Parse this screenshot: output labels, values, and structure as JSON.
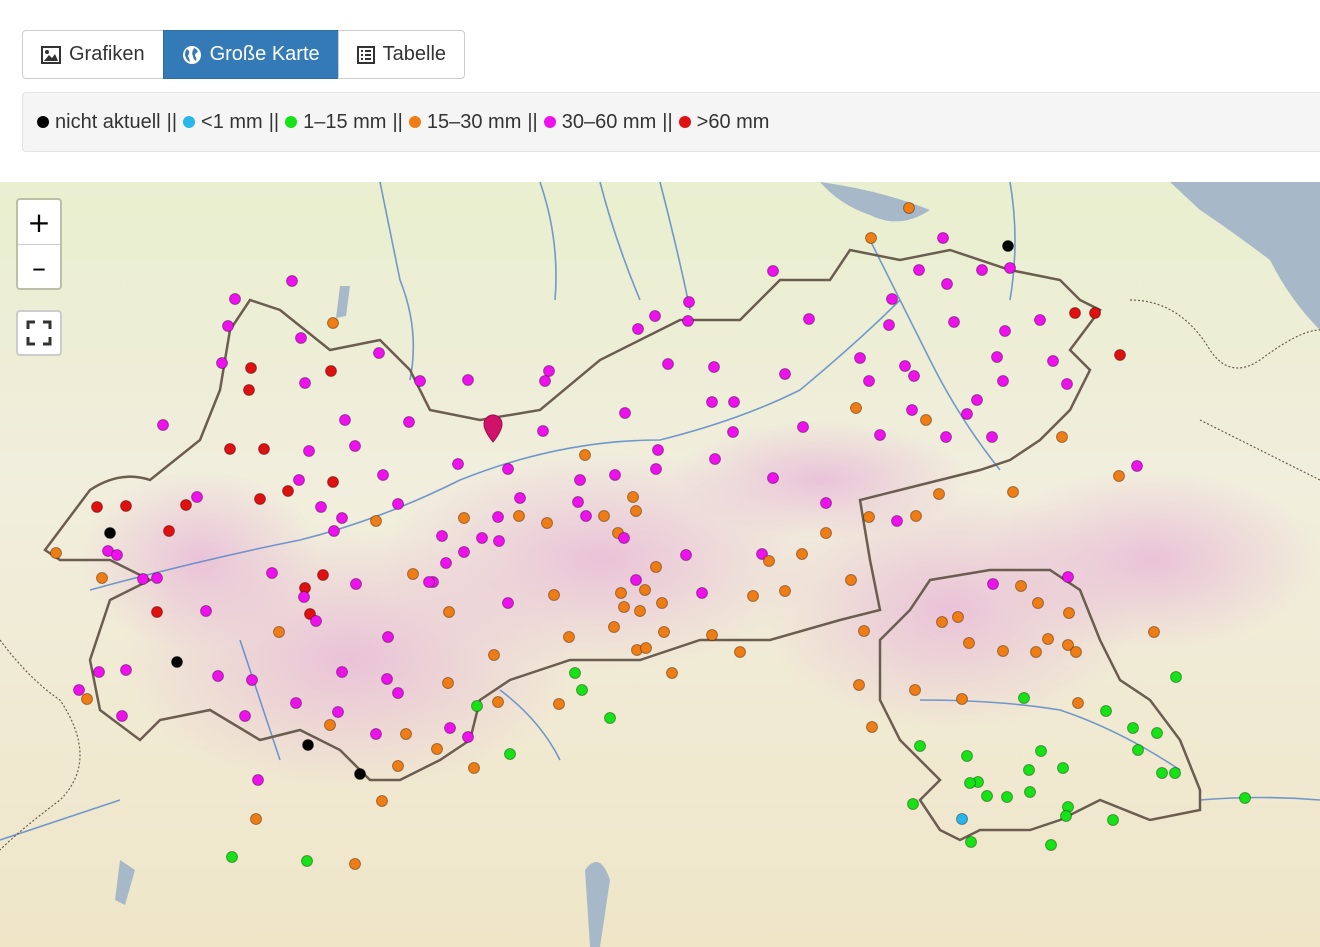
{
  "tabs": [
    {
      "label": "Grafiken",
      "icon": "image-icon",
      "active": false
    },
    {
      "label": "Große Karte",
      "icon": "globe-icon",
      "active": true
    },
    {
      "label": "Tabelle",
      "icon": "list-icon",
      "active": false
    }
  ],
  "legend": {
    "items": [
      {
        "label": "nicht aktuell",
        "color": "#000000"
      },
      {
        "label": "<1 mm",
        "color": "#29b6e8"
      },
      {
        "label": "1–15 mm",
        "color": "#16e316"
      },
      {
        "label": "15–30 mm",
        "color": "#f07d14"
      },
      {
        "label": "30–60 mm",
        "color": "#ee11ee"
      },
      {
        "label": ">60 mm",
        "color": "#e01010"
      }
    ],
    "separator": "||"
  },
  "map_controls": {
    "zoom_in": "+",
    "zoom_out": "–",
    "fullscreen_icon": "fullscreen-icon"
  },
  "colors": {
    "black": "#000000",
    "blue": "#29b6e8",
    "green": "#16e316",
    "orange": "#f07d14",
    "magenta": "#ee11ee",
    "red": "#e01010"
  },
  "stations": [
    [
      333,
      323,
      "o"
    ],
    [
      292,
      281,
      "m"
    ],
    [
      235,
      299,
      "m"
    ],
    [
      228,
      326,
      "m"
    ],
    [
      301,
      338,
      "m"
    ],
    [
      379,
      353,
      "m"
    ],
    [
      222,
      363,
      "m"
    ],
    [
      251,
      368,
      "r"
    ],
    [
      305,
      383,
      "m"
    ],
    [
      331,
      371,
      "r"
    ],
    [
      249,
      390,
      "r"
    ],
    [
      163,
      425,
      "m"
    ],
    [
      345,
      420,
      "m"
    ],
    [
      420,
      381,
      "m"
    ],
    [
      468,
      380,
      "m"
    ],
    [
      409,
      422,
      "m"
    ],
    [
      230,
      449,
      "r"
    ],
    [
      264,
      449,
      "r"
    ],
    [
      309,
      451,
      "m"
    ],
    [
      355,
      446,
      "m"
    ],
    [
      383,
      475,
      "m"
    ],
    [
      458,
      464,
      "m"
    ],
    [
      333,
      482,
      "r"
    ],
    [
      288,
      491,
      "r"
    ],
    [
      299,
      480,
      "m"
    ],
    [
      197,
      497,
      "m"
    ],
    [
      186,
      505,
      "r"
    ],
    [
      260,
      499,
      "r"
    ],
    [
      126,
      506,
      "r"
    ],
    [
      97,
      507,
      "r"
    ],
    [
      110,
      533,
      "k"
    ],
    [
      169,
      531,
      "r"
    ],
    [
      321,
      507,
      "m"
    ],
    [
      342,
      518,
      "m"
    ],
    [
      398,
      504,
      "m"
    ],
    [
      376,
      521,
      "o"
    ],
    [
      334,
      531,
      "m"
    ],
    [
      56,
      553,
      "o"
    ],
    [
      108,
      551,
      "m"
    ],
    [
      117,
      555,
      "m"
    ],
    [
      102,
      578,
      "o"
    ],
    [
      143,
      579,
      "m"
    ],
    [
      157,
      578,
      "m"
    ],
    [
      272,
      573,
      "m"
    ],
    [
      305,
      588,
      "r"
    ],
    [
      323,
      575,
      "r"
    ],
    [
      356,
      584,
      "m"
    ],
    [
      157,
      612,
      "r"
    ],
    [
      206,
      611,
      "m"
    ],
    [
      304,
      597,
      "m"
    ],
    [
      310,
      614,
      "r"
    ],
    [
      316,
      621,
      "m"
    ],
    [
      279,
      632,
      "o"
    ],
    [
      177,
      662,
      "k"
    ],
    [
      99,
      672,
      "m"
    ],
    [
      126,
      670,
      "m"
    ],
    [
      79,
      690,
      "m"
    ],
    [
      87,
      699,
      "o"
    ],
    [
      218,
      676,
      "m"
    ],
    [
      252,
      680,
      "m"
    ],
    [
      342,
      672,
      "m"
    ],
    [
      388,
      637,
      "m"
    ],
    [
      387,
      679,
      "m"
    ],
    [
      398,
      693,
      "m"
    ],
    [
      296,
      703,
      "m"
    ],
    [
      338,
      712,
      "m"
    ],
    [
      245,
      716,
      "m"
    ],
    [
      122,
      716,
      "m"
    ],
    [
      308,
      745,
      "k"
    ],
    [
      330,
      725,
      "o"
    ],
    [
      376,
      734,
      "m"
    ],
    [
      406,
      734,
      "o"
    ],
    [
      360,
      774,
      "k"
    ],
    [
      398,
      766,
      "o"
    ],
    [
      437,
      749,
      "o"
    ],
    [
      450,
      728,
      "m"
    ],
    [
      468,
      737,
      "m"
    ],
    [
      474,
      768,
      "o"
    ],
    [
      382,
      801,
      "o"
    ],
    [
      258,
      780,
      "m"
    ],
    [
      256,
      819,
      "o"
    ],
    [
      232,
      857,
      "g"
    ],
    [
      307,
      861,
      "g"
    ],
    [
      355,
      864,
      "o"
    ],
    [
      442,
      536,
      "m"
    ],
    [
      464,
      518,
      "o"
    ],
    [
      464,
      552,
      "m"
    ],
    [
      482,
      538,
      "m"
    ],
    [
      499,
      541,
      "m"
    ],
    [
      498,
      517,
      "m"
    ],
    [
      519,
      516,
      "o"
    ],
    [
      520,
      498,
      "m"
    ],
    [
      547,
      523,
      "o"
    ],
    [
      508,
      469,
      "m"
    ],
    [
      543,
      431,
      "m"
    ],
    [
      549,
      371,
      "m"
    ],
    [
      545,
      381,
      "m"
    ],
    [
      585,
      455,
      "o"
    ],
    [
      580,
      480,
      "m"
    ],
    [
      615,
      475,
      "m"
    ],
    [
      578,
      502,
      "m"
    ],
    [
      586,
      516,
      "m"
    ],
    [
      604,
      516,
      "o"
    ],
    [
      618,
      533,
      "o"
    ],
    [
      624,
      538,
      "m"
    ],
    [
      633,
      497,
      "o"
    ],
    [
      636,
      511,
      "o"
    ],
    [
      625,
      413,
      "m"
    ],
    [
      655,
      316,
      "m"
    ],
    [
      638,
      329,
      "m"
    ],
    [
      689,
      302,
      "m"
    ],
    [
      688,
      321,
      "m"
    ],
    [
      668,
      364,
      "m"
    ],
    [
      714,
      367,
      "m"
    ],
    [
      712,
      402,
      "m"
    ],
    [
      734,
      402,
      "m"
    ],
    [
      658,
      450,
      "m"
    ],
    [
      656,
      469,
      "m"
    ],
    [
      715,
      459,
      "m"
    ],
    [
      733,
      432,
      "m"
    ],
    [
      773,
      271,
      "m"
    ],
    [
      809,
      319,
      "m"
    ],
    [
      785,
      374,
      "m"
    ],
    [
      803,
      427,
      "m"
    ],
    [
      773,
      478,
      "m"
    ],
    [
      826,
      503,
      "m"
    ],
    [
      826,
      533,
      "o"
    ],
    [
      802,
      554,
      "o"
    ],
    [
      762,
      554,
      "m"
    ],
    [
      769,
      561,
      "o"
    ],
    [
      753,
      596,
      "o"
    ],
    [
      785,
      591,
      "o"
    ],
    [
      686,
      555,
      "m"
    ],
    [
      656,
      567,
      "o"
    ],
    [
      636,
      580,
      "m"
    ],
    [
      645,
      590,
      "o"
    ],
    [
      621,
      593,
      "o"
    ],
    [
      624,
      607,
      "o"
    ],
    [
      640,
      611,
      "o"
    ],
    [
      662,
      603,
      "o"
    ],
    [
      702,
      593,
      "m"
    ],
    [
      614,
      627,
      "o"
    ],
    [
      637,
      650,
      "o"
    ],
    [
      646,
      648,
      "o"
    ],
    [
      664,
      632,
      "o"
    ],
    [
      712,
      635,
      "o"
    ],
    [
      740,
      652,
      "o"
    ],
    [
      672,
      673,
      "o"
    ],
    [
      851,
      580,
      "o"
    ],
    [
      864,
      631,
      "o"
    ],
    [
      569,
      637,
      "o"
    ],
    [
      554,
      595,
      "o"
    ],
    [
      508,
      603,
      "m"
    ],
    [
      449,
      612,
      "o"
    ],
    [
      433,
      582,
      "m"
    ],
    [
      446,
      563,
      "m"
    ],
    [
      413,
      574,
      "o"
    ],
    [
      429,
      582,
      "m"
    ],
    [
      494,
      655,
      "o"
    ],
    [
      448,
      683,
      "o"
    ],
    [
      498,
      702,
      "o"
    ],
    [
      477,
      706,
      "g"
    ],
    [
      510,
      754,
      "g"
    ],
    [
      575,
      673,
      "g"
    ],
    [
      582,
      690,
      "g"
    ],
    [
      559,
      704,
      "o"
    ],
    [
      610,
      718,
      "g"
    ],
    [
      909,
      208,
      "o"
    ],
    [
      871,
      238,
      "o"
    ],
    [
      943,
      238,
      "m"
    ],
    [
      1008,
      246,
      "k"
    ],
    [
      1010,
      268,
      "m"
    ],
    [
      919,
      270,
      "m"
    ],
    [
      947,
      284,
      "m"
    ],
    [
      982,
      270,
      "m"
    ],
    [
      892,
      299,
      "m"
    ],
    [
      889,
      325,
      "m"
    ],
    [
      860,
      358,
      "m"
    ],
    [
      905,
      366,
      "m"
    ],
    [
      914,
      376,
      "m"
    ],
    [
      869,
      381,
      "m"
    ],
    [
      856,
      408,
      "o"
    ],
    [
      912,
      410,
      "m"
    ],
    [
      926,
      420,
      "o"
    ],
    [
      954,
      322,
      "m"
    ],
    [
      1005,
      331,
      "m"
    ],
    [
      1040,
      320,
      "m"
    ],
    [
      997,
      357,
      "m"
    ],
    [
      1053,
      361,
      "m"
    ],
    [
      1003,
      381,
      "m"
    ],
    [
      977,
      400,
      "m"
    ],
    [
      967,
      414,
      "m"
    ],
    [
      946,
      437,
      "m"
    ],
    [
      992,
      437,
      "m"
    ],
    [
      1075,
      313,
      "r"
    ],
    [
      1095,
      313,
      "r"
    ],
    [
      1120,
      355,
      "r"
    ],
    [
      1067,
      384,
      "m"
    ],
    [
      1062,
      437,
      "o"
    ],
    [
      1137,
      466,
      "m"
    ],
    [
      1119,
      476,
      "o"
    ],
    [
      1013,
      492,
      "o"
    ],
    [
      939,
      494,
      "o"
    ],
    [
      916,
      516,
      "o"
    ],
    [
      897,
      521,
      "m"
    ],
    [
      869,
      517,
      "o"
    ],
    [
      880,
      435,
      "m"
    ],
    [
      993,
      584,
      "m"
    ],
    [
      1021,
      586,
      "o"
    ],
    [
      1068,
      577,
      "m"
    ],
    [
      1038,
      603,
      "o"
    ],
    [
      1069,
      613,
      "o"
    ],
    [
      958,
      617,
      "o"
    ],
    [
      942,
      622,
      "o"
    ],
    [
      969,
      643,
      "o"
    ],
    [
      1003,
      651,
      "o"
    ],
    [
      1036,
      652,
      "o"
    ],
    [
      1048,
      639,
      "o"
    ],
    [
      1068,
      645,
      "o"
    ],
    [
      1076,
      652,
      "o"
    ],
    [
      1154,
      632,
      "o"
    ],
    [
      1176,
      677,
      "g"
    ],
    [
      859,
      685,
      "o"
    ],
    [
      915,
      690,
      "o"
    ],
    [
      962,
      699,
      "o"
    ],
    [
      1024,
      698,
      "g"
    ],
    [
      1078,
      703,
      "o"
    ],
    [
      1106,
      711,
      "g"
    ],
    [
      1133,
      728,
      "g"
    ],
    [
      1157,
      733,
      "g"
    ],
    [
      872,
      727,
      "o"
    ],
    [
      920,
      746,
      "g"
    ],
    [
      967,
      756,
      "g"
    ],
    [
      1041,
      751,
      "g"
    ],
    [
      1138,
      750,
      "g"
    ],
    [
      1029,
      770,
      "g"
    ],
    [
      1063,
      768,
      "g"
    ],
    [
      1162,
      773,
      "g"
    ],
    [
      1175,
      773,
      "g"
    ],
    [
      978,
      782,
      "g"
    ],
    [
      970,
      783,
      "g"
    ],
    [
      987,
      796,
      "g"
    ],
    [
      1007,
      797,
      "g"
    ],
    [
      1030,
      792,
      "g"
    ],
    [
      913,
      804,
      "g"
    ],
    [
      1068,
      807,
      "g"
    ],
    [
      1066,
      816,
      "g"
    ],
    [
      1113,
      820,
      "g"
    ],
    [
      1245,
      798,
      "g"
    ],
    [
      962,
      819,
      "b"
    ],
    [
      971,
      842,
      "g"
    ],
    [
      1051,
      845,
      "g"
    ]
  ]
}
